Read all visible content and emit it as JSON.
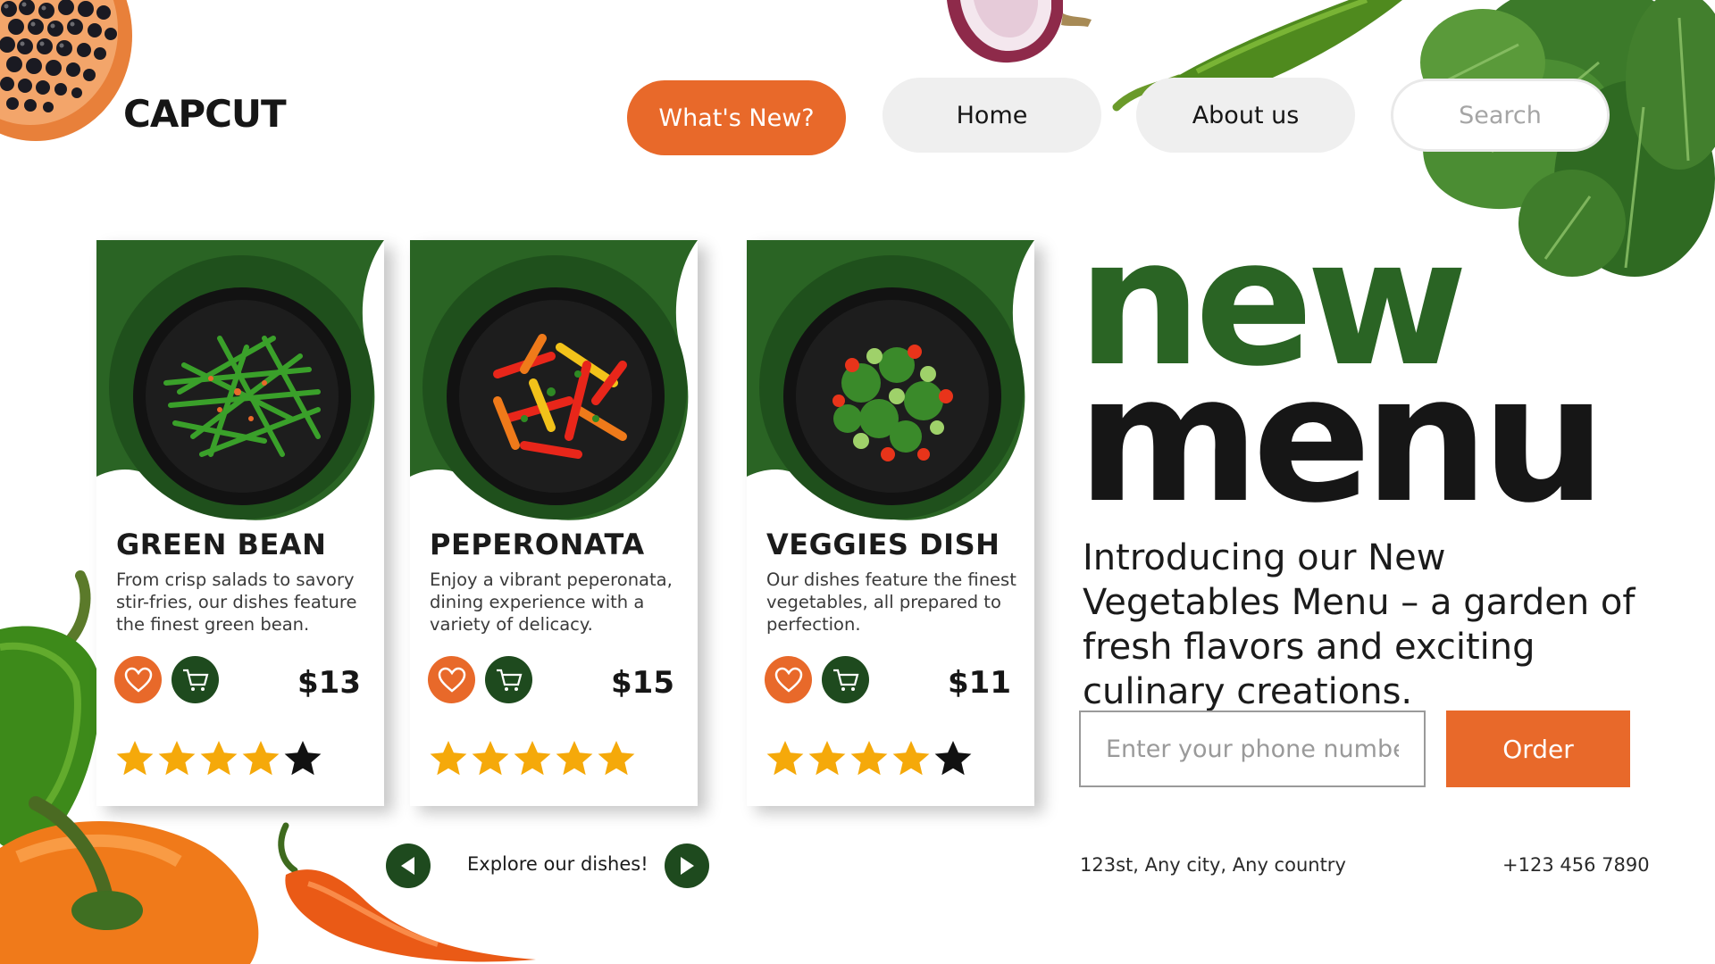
{
  "brand": {
    "logo_text": "CAPCUT"
  },
  "nav": {
    "whats_new": "What's New?",
    "home": "Home",
    "about": "About us",
    "search_placeholder": "Search"
  },
  "colors": {
    "accent_orange": "#e8692a",
    "brand_green": "#2a6424",
    "dark_green": "#1e4a1e",
    "ink": "#161616"
  },
  "cards": [
    {
      "title": "Green Bean",
      "description": "From crisp salads to savory stir-fries, our dishes feature the finest green bean.",
      "price": "$13",
      "rating": 4,
      "rating_max": 5
    },
    {
      "title": "Peperonata",
      "description": "Enjoy a vibrant peperonata, dining experience with a variety of delicacy.",
      "price": "$15",
      "rating": 5,
      "rating_max": 5
    },
    {
      "title": "Veggies Dish",
      "description": "Our dishes feature the finest vegetables, all prepared to perfection.",
      "price": "$11",
      "rating": 4,
      "rating_max": 5
    }
  ],
  "card_icons": {
    "like": "heart-icon",
    "cart": "cart-icon"
  },
  "carousel": {
    "label": "Explore our dishes!",
    "prev_icon": "chevron-left-icon",
    "next_icon": "chevron-right-icon"
  },
  "hero": {
    "line1": "new",
    "line2": "menu",
    "intro": "Introducing our New Vegetables Menu – a garden of fresh flavors and exciting culinary creations."
  },
  "order_form": {
    "phone_placeholder": "Enter your phone number",
    "order_label": "Order"
  },
  "footer": {
    "address": "123st, Any city, Any country",
    "phone": "+123 456 7890"
  }
}
